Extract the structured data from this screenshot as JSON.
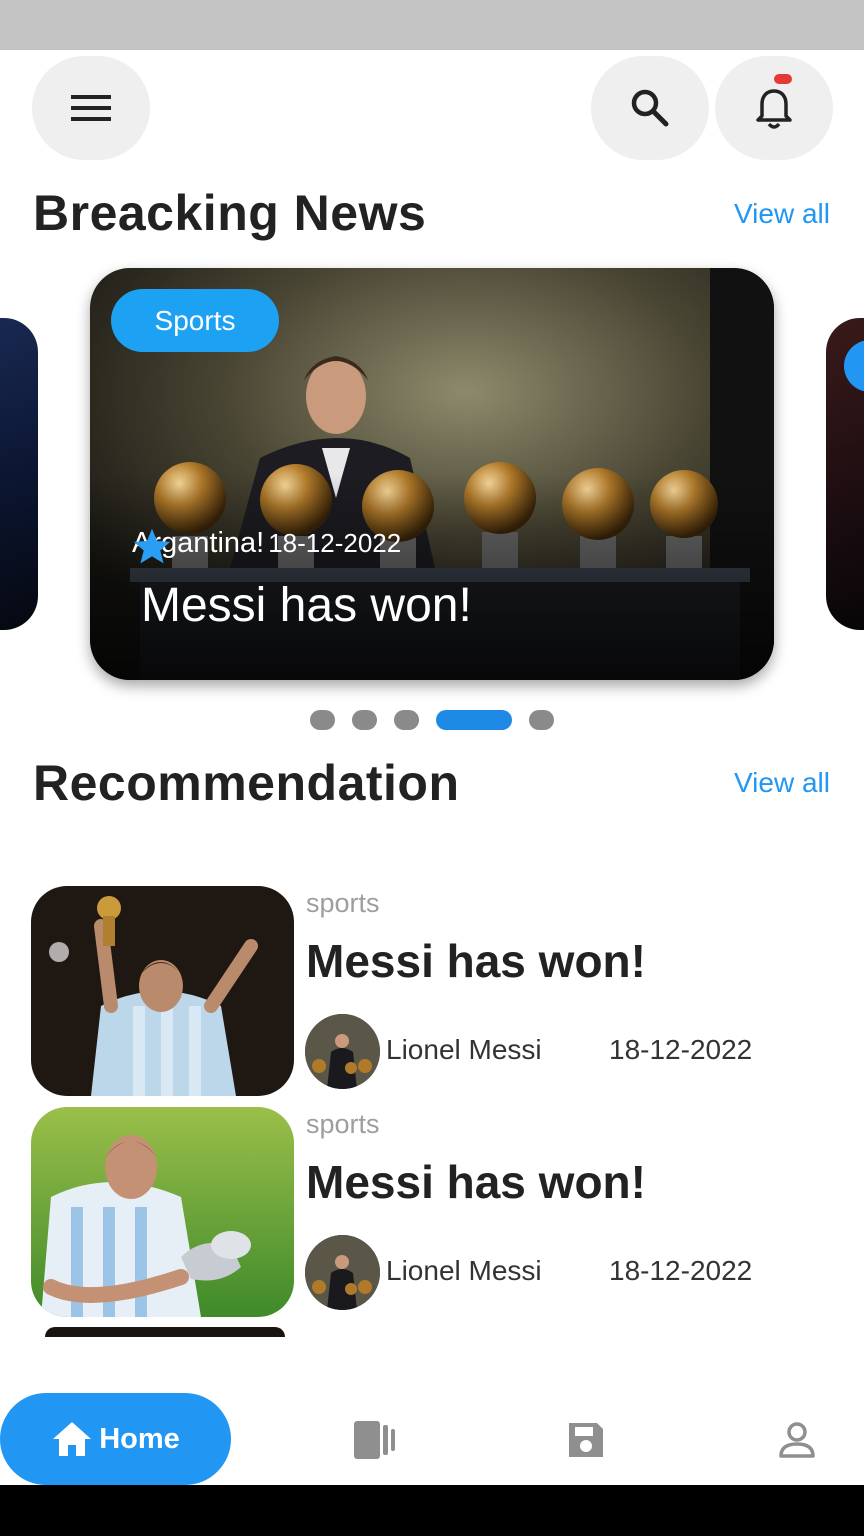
{
  "header": {
    "menu_icon": "menu-icon",
    "search_icon": "search-icon",
    "bell_icon": "bell-icon",
    "notification_color": "#e53935"
  },
  "breaking": {
    "title": "Breacking News",
    "view_all": "View all",
    "card": {
      "category": "Sports",
      "country": "Argantina!",
      "date": "18-12-2022",
      "headline": "Messi has won!"
    },
    "carousel": {
      "count": 5,
      "active": 4
    }
  },
  "recommendation": {
    "title": "Recommendation",
    "view_all": "View all",
    "items": [
      {
        "category": "sports",
        "title": "Messi has won!",
        "author": "Lionel Messi",
        "date": "18-12-2022"
      },
      {
        "category": "sports",
        "title": "Messi has won!",
        "author": "Lionel Messi",
        "date": "18-12-2022"
      }
    ]
  },
  "bottom_nav": {
    "home_label": "Home",
    "items": [
      "home-icon",
      "cards-icon",
      "save-icon",
      "profile-icon"
    ],
    "accent": "#2196f3"
  }
}
